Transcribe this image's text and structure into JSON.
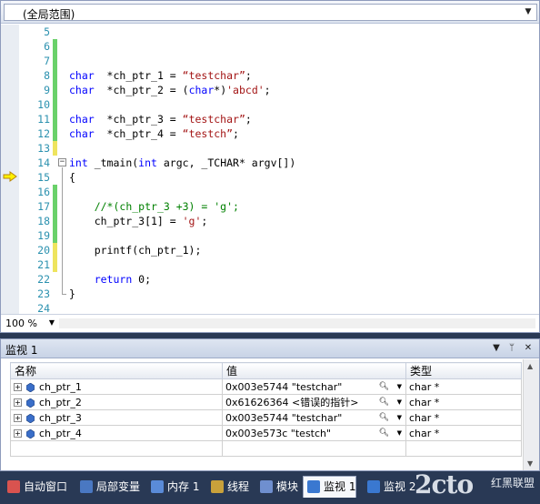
{
  "editor": {
    "scope": "(全局范围)",
    "zoom": "100 %",
    "current_line": 15,
    "lines": [
      {
        "no": "5",
        "mark": "",
        "parts": []
      },
      {
        "no": "6",
        "mark": "g",
        "parts": []
      },
      {
        "no": "7",
        "mark": "g",
        "parts": []
      },
      {
        "no": "8",
        "mark": "g",
        "parts": [
          [
            "kw",
            "char"
          ],
          [
            "",
            "  *ch_ptr_1 = "
          ],
          [
            "str",
            "“testchar”"
          ],
          [
            "",
            ";"
          ]
        ]
      },
      {
        "no": "9",
        "mark": "g",
        "parts": [
          [
            "kw",
            "char"
          ],
          [
            "",
            "  *ch_ptr_2 = ("
          ],
          [
            "kw",
            "char"
          ],
          [
            "",
            "*)"
          ],
          [
            "str",
            "'abcd'"
          ],
          [
            "",
            ";"
          ]
        ]
      },
      {
        "no": "10",
        "mark": "g",
        "parts": []
      },
      {
        "no": "11",
        "mark": "g",
        "parts": [
          [
            "kw",
            "char"
          ],
          [
            "",
            "  *ch_ptr_3 = "
          ],
          [
            "str",
            "“testchar”"
          ],
          [
            "",
            ";"
          ]
        ]
      },
      {
        "no": "12",
        "mark": "g",
        "parts": [
          [
            "kw",
            "char"
          ],
          [
            "",
            "  *ch_ptr_4 = "
          ],
          [
            "str",
            "“testch”"
          ],
          [
            "",
            ";"
          ]
        ]
      },
      {
        "no": "13",
        "mark": "y",
        "parts": []
      },
      {
        "no": "14",
        "mark": "",
        "parts": [
          [
            "kw",
            "int"
          ],
          [
            "",
            " _tmain("
          ],
          [
            "kw",
            "int"
          ],
          [
            "",
            " argc, _TCHAR* argv[])"
          ]
        ]
      },
      {
        "no": "15",
        "mark": "",
        "parts": [
          [
            "",
            "{"
          ]
        ]
      },
      {
        "no": "16",
        "mark": "g",
        "parts": []
      },
      {
        "no": "17",
        "mark": "g",
        "parts": [
          [
            "",
            "    "
          ],
          [
            "cm",
            "//*(ch_ptr_3 +3) = 'g';"
          ]
        ]
      },
      {
        "no": "18",
        "mark": "g",
        "parts": [
          [
            "",
            "    ch_ptr_3[1] = "
          ],
          [
            "str",
            "'g'"
          ],
          [
            "",
            ";"
          ]
        ]
      },
      {
        "no": "19",
        "mark": "g",
        "parts": []
      },
      {
        "no": "20",
        "mark": "y",
        "parts": [
          [
            "",
            "    printf(ch_ptr_1);"
          ]
        ]
      },
      {
        "no": "21",
        "mark": "y",
        "parts": []
      },
      {
        "no": "22",
        "mark": "",
        "parts": [
          [
            "",
            "    "
          ],
          [
            "kw",
            "return"
          ],
          [
            "",
            " 0;"
          ]
        ]
      },
      {
        "no": "23",
        "mark": "",
        "parts": [
          [
            "",
            "}"
          ]
        ]
      },
      {
        "no": "24",
        "mark": "",
        "parts": []
      }
    ]
  },
  "watch": {
    "title": "监视 1",
    "headers": {
      "name": "名称",
      "value": "值",
      "type": "类型"
    },
    "rows": [
      {
        "name": "ch_ptr_1",
        "value": "0x003e5744 \"testchar\"",
        "type": "char *"
      },
      {
        "name": "ch_ptr_2",
        "value": "0x61626364 <错误的指针>",
        "type": "char *"
      },
      {
        "name": "ch_ptr_3",
        "value": "0x003e5744 \"testchar\"",
        "type": "char *"
      },
      {
        "name": "ch_ptr_4",
        "value": "0x003e573c \"testch\"",
        "type": "char *"
      }
    ]
  },
  "tabs": [
    {
      "label": "自动窗口",
      "icon": "autos-icon",
      "color": "#d9534f"
    },
    {
      "label": "局部变量",
      "icon": "locals-icon",
      "color": "#4a78c2"
    },
    {
      "label": "内存 1",
      "icon": "memory-icon",
      "color": "#5a8bd8"
    },
    {
      "label": "线程",
      "icon": "threads-icon",
      "color": "#c9a13b"
    },
    {
      "label": "模块",
      "icon": "modules-icon",
      "color": "#6f8fcf"
    },
    {
      "label": "监视 1",
      "icon": "watch-icon",
      "color": "#3a78d0"
    },
    {
      "label": "监视 2",
      "icon": "watch-icon",
      "color": "#3a78d0"
    }
  ],
  "active_tab": 5,
  "watermark": {
    "big": "2cto",
    "small": "红黑联盟"
  }
}
